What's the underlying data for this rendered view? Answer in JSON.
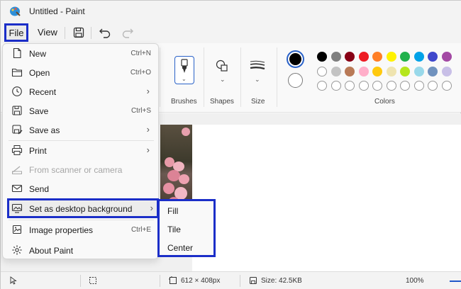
{
  "window": {
    "title": "Untitled - Paint"
  },
  "menubar": {
    "file_label": "File",
    "view_label": "View"
  },
  "ribbon": {
    "groups": {
      "brushes": "Brushes",
      "shapes": "Shapes",
      "size": "Size",
      "colors": "Colors"
    }
  },
  "colors": {
    "current_primary": "#000000",
    "current_secondary": "#ffffff",
    "row1": [
      "#000000",
      "#7f7f7f",
      "#880015",
      "#ed1c24",
      "#ff7f27",
      "#fff200",
      "#22b14c",
      "#00a2e8",
      "#3f48cc",
      "#a349a4"
    ],
    "row2": [
      "#ffffff",
      "#c3c3c3",
      "#b97a57",
      "#ffaec9",
      "#ffc90e",
      "#efe4b0",
      "#b5e61d",
      "#99d9ea",
      "#7092be",
      "#c8bfe7"
    ],
    "row3_empty_count": 10
  },
  "file_menu": {
    "items": [
      {
        "label": "New",
        "shortcut": "Ctrl+N",
        "icon": "new-file-icon"
      },
      {
        "label": "Open",
        "shortcut": "Ctrl+O",
        "icon": "folder-icon"
      },
      {
        "label": "Recent",
        "icon": "clock-icon",
        "submenu": true
      },
      {
        "label": "Save",
        "shortcut": "Ctrl+S",
        "icon": "save-icon"
      },
      {
        "label": "Save as",
        "icon": "save-as-icon",
        "submenu": true
      },
      {
        "label": "Print",
        "icon": "printer-icon",
        "submenu": true
      },
      {
        "label": "From scanner or camera",
        "icon": "scanner-icon",
        "disabled": true
      },
      {
        "label": "Send",
        "icon": "send-icon"
      },
      {
        "label": "Set as desktop background",
        "icon": "desktop-background-icon",
        "submenu": true,
        "highlighted": true
      },
      {
        "label": "Image properties",
        "shortcut": "Ctrl+E",
        "icon": "image-properties-icon"
      },
      {
        "label": "About Paint",
        "icon": "gear-icon"
      }
    ]
  },
  "submenu": {
    "items": [
      "Fill",
      "Tile",
      "Center"
    ]
  },
  "status": {
    "dimensions": "612 × 408px",
    "size": "Size: 42.5KB",
    "zoom": "100%"
  }
}
